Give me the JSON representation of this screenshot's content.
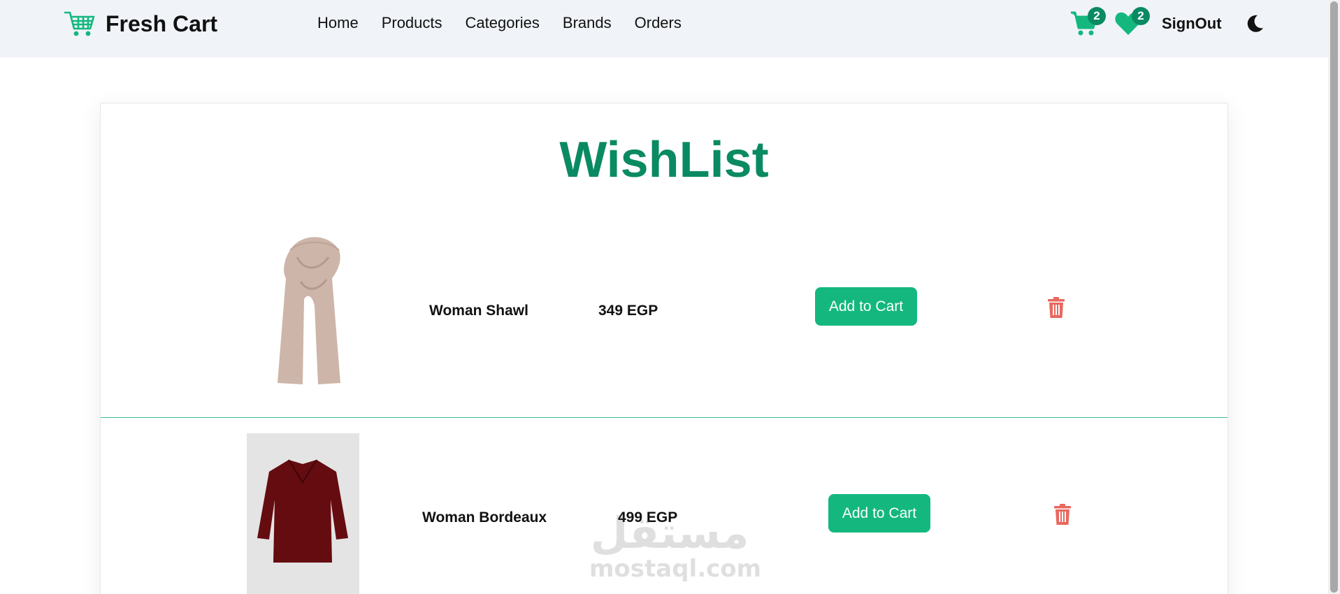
{
  "brand": {
    "name": "Fresh Cart",
    "icon": "shopping-cart-icon",
    "color": "#14b87e"
  },
  "nav": {
    "links": [
      "Home",
      "Products",
      "Categories",
      "Brands",
      "Orders"
    ],
    "cart_count": "2",
    "wishlist_count": "2",
    "signout_label": "SignOut",
    "theme_icon": "moon-icon"
  },
  "wishlist": {
    "title": "WishList",
    "items": [
      {
        "name": "Woman Shawl",
        "price": "349 EGP",
        "button": "Add to Cart",
        "image": "beige-shawl"
      },
      {
        "name": "Woman Bordeaux",
        "price": "499 EGP",
        "button": "Add to Cart",
        "image": "bordeaux-blouse"
      }
    ]
  },
  "watermark": {
    "arabic": "مستقل",
    "latin": "mostaql.com"
  },
  "colors": {
    "accent": "#14b87e",
    "title": "#0a8a62",
    "delete": "#e8675f",
    "navbar": "#f0f3f8"
  }
}
